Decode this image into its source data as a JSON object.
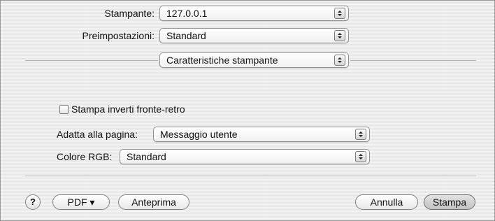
{
  "form": {
    "printer": {
      "label": "Stampante:",
      "value": "127.0.0.1"
    },
    "presets": {
      "label": "Preimpostazioni:",
      "value": "Standard"
    },
    "panel_selector": {
      "value": "Caratteristiche stampante"
    }
  },
  "features": {
    "duplex": {
      "label": "Stampa inverti fronte-retro",
      "checked": false
    },
    "fit_to_page": {
      "label": "Adatta alla pagina:",
      "value": "Messaggio utente"
    },
    "rgb_color": {
      "label": "Colore RGB:",
      "value": "Standard"
    }
  },
  "footer": {
    "help_glyph": "?",
    "pdf_label": "PDF ▾",
    "preview_label": "Anteprima",
    "cancel_label": "Annulla",
    "print_label": "Stampa"
  },
  "icons": {
    "popup_arrows": "popup-arrows-icon",
    "help": "help-icon"
  }
}
